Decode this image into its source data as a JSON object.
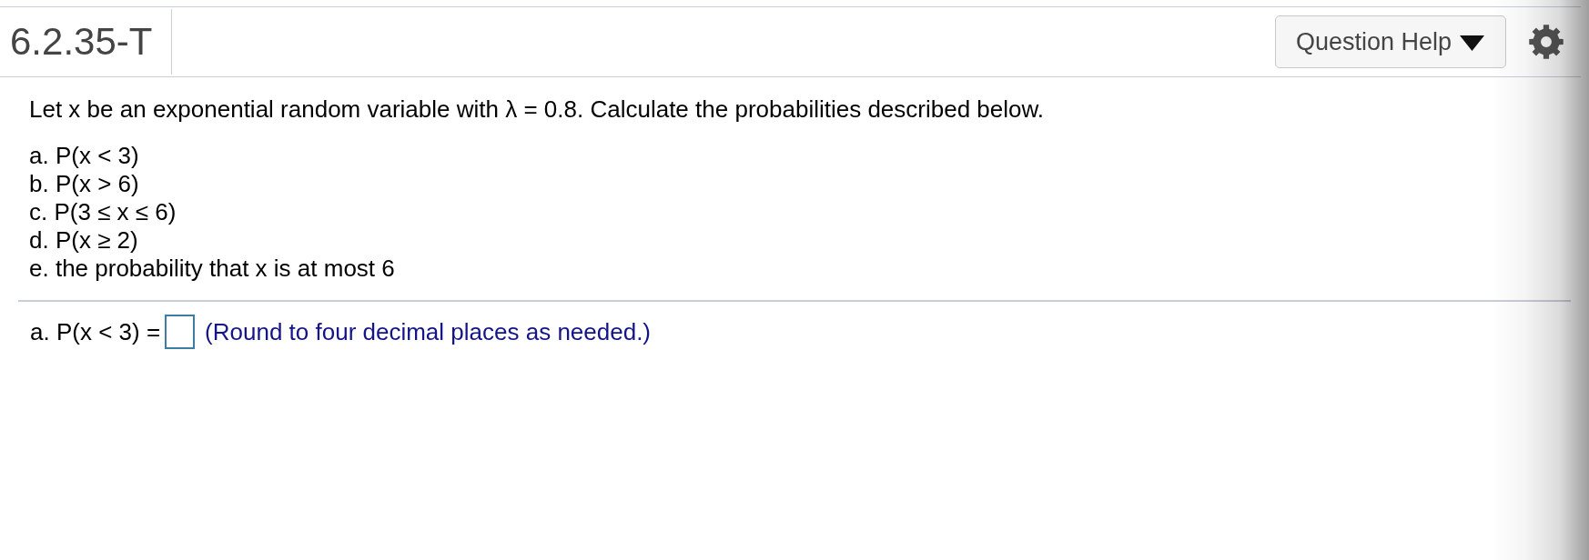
{
  "header": {
    "title": "6.2.35-T",
    "help_button": {
      "label": "Question Help"
    }
  },
  "question": {
    "intro": "Let x be an exponential random variable with λ = 0.8. Calculate the probabilities described below.",
    "parts": [
      "a. P(x < 3)",
      "b. P(x > 6)",
      "c. P(3 ≤ x ≤ 6)",
      "d. P(x ≥ 2)",
      "e. the probability that x is at most 6"
    ]
  },
  "answer": {
    "prompt": "a. P(x < 3) =",
    "hint": "(Round to four decimal places as needed.)"
  }
}
